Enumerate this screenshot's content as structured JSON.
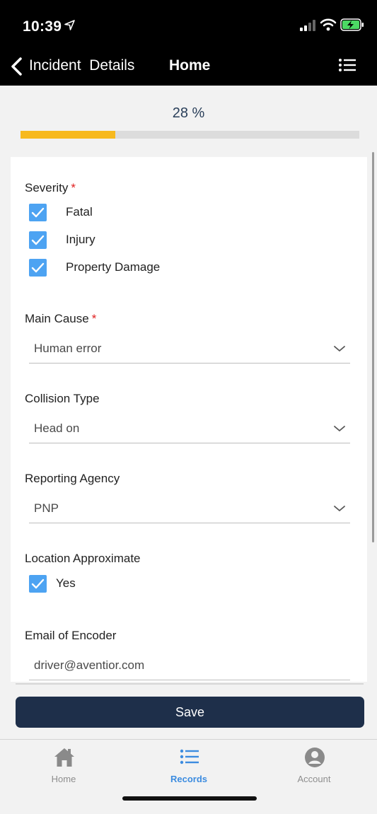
{
  "status_bar": {
    "time": "10:39"
  },
  "nav": {
    "back_label": "Incident  Details",
    "title": "Home"
  },
  "progress": {
    "label": "28 %",
    "value_percent": 28,
    "fill_color": "#f7b91e"
  },
  "form": {
    "severity": {
      "label": "Severity",
      "required_mark": "*",
      "options": [
        {
          "label": "Fatal",
          "checked": true
        },
        {
          "label": "Injury",
          "checked": true
        },
        {
          "label": "Property Damage",
          "checked": true
        }
      ]
    },
    "main_cause": {
      "label": "Main Cause",
      "required_mark": "*",
      "value": "Human error"
    },
    "collision_type": {
      "label": "Collision Type",
      "value": "Head on"
    },
    "reporting_agency": {
      "label": "Reporting Agency",
      "value": "PNP"
    },
    "location_approximate": {
      "label": "Location Approximate",
      "option_label": "Yes",
      "checked": true
    },
    "email_of_encoder": {
      "label": "Email of Encoder",
      "value": "driver@aventior.com"
    }
  },
  "save_label": "Save",
  "tabs": [
    {
      "label": "Home",
      "icon": "house-icon",
      "active": false
    },
    {
      "label": "Records",
      "icon": "list-icon",
      "active": true
    },
    {
      "label": "Account",
      "icon": "person-icon",
      "active": false
    }
  ],
  "colors": {
    "accent": "#3c8ce0",
    "checkbox": "#4da3f2",
    "primary_button": "#1e2f4a",
    "required": "#e02020"
  }
}
